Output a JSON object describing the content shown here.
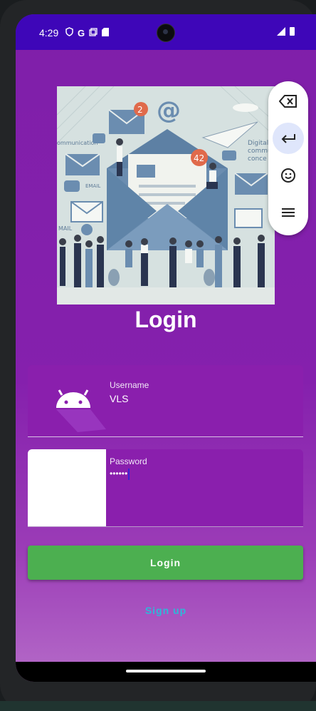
{
  "status_bar": {
    "time": "4:29",
    "icons": [
      "shield-icon",
      "google-icon",
      "copy-icon",
      "sd-card-icon"
    ],
    "right_icons": [
      "signal-icon",
      "battery-icon"
    ]
  },
  "hero_image": {
    "texts": {
      "badge_top": "2",
      "badge_mid": "42",
      "left_label": "ommunication",
      "right_label_1": "Digital",
      "right_label_2": "commu",
      "right_label_3": "conce",
      "email_1": "EMAIL",
      "email_2": "MAIL"
    }
  },
  "page": {
    "title": "Login"
  },
  "form": {
    "username": {
      "label": "Username",
      "value": "VLS"
    },
    "password": {
      "label": "Password",
      "value": "••••••"
    },
    "login_button": "Login",
    "signup_link": "Sign up"
  },
  "floating_toolbar": {
    "buttons": [
      "backspace-icon",
      "enter-icon",
      "emoji-icon",
      "menu-icon"
    ]
  },
  "colors": {
    "status_bar": "#3e06b8",
    "background": "#8520ad",
    "login_button": "#4caf50",
    "signup_link": "#2eb8d8"
  }
}
